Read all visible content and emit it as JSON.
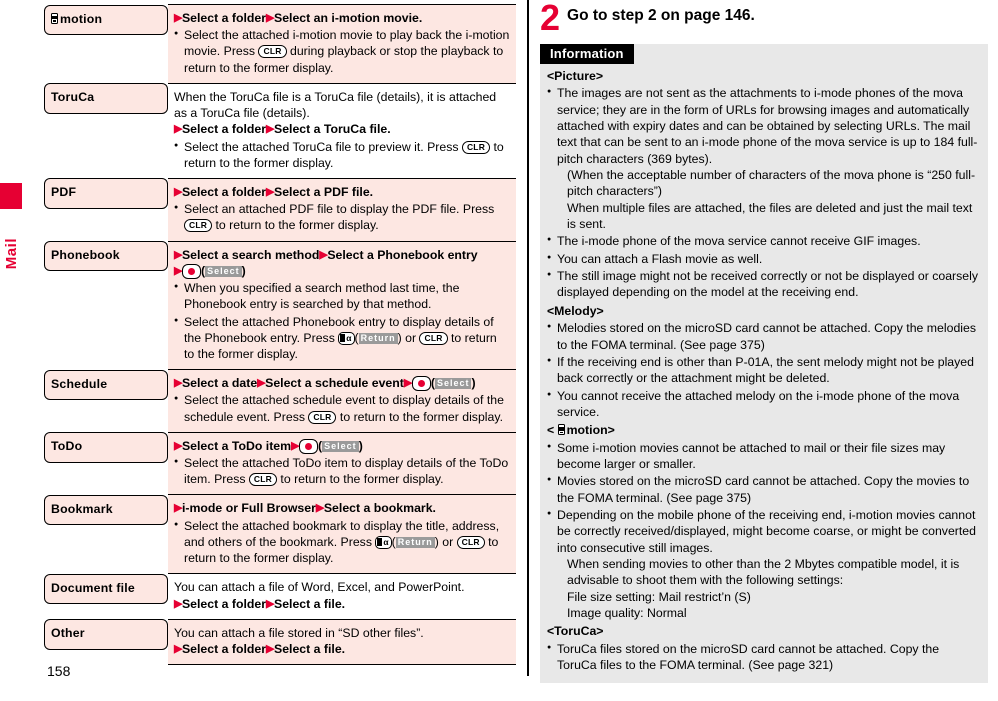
{
  "side_tab": {
    "label": "Mail"
  },
  "page_number": "158",
  "table": {
    "rows": [
      {
        "key_icon": "i-motion-glyph",
        "key": "motion",
        "value_bg": "pink",
        "lines": [
          {
            "type": "steps",
            "steps": [
              "Select a folder",
              "Select an i-motion movie."
            ]
          },
          {
            "type": "bullet",
            "parts": [
              {
                "t": "text",
                "v": "Select the attached i-motion movie to play back the i-motion movie. Press "
              },
              {
                "t": "key",
                "v": "CLR"
              },
              {
                "t": "text",
                "v": " during playback or stop the playback to return to the former display."
              }
            ]
          }
        ]
      },
      {
        "key": "ToruCa",
        "value_bg": "white",
        "lines": [
          {
            "type": "plain",
            "parts": [
              {
                "t": "text",
                "v": "When the ToruCa file is a ToruCa file (details), it is attached as a ToruCa file (details)."
              }
            ]
          },
          {
            "type": "steps",
            "steps": [
              "Select a folder",
              "Select a ToruCa file."
            ]
          },
          {
            "type": "bullet",
            "parts": [
              {
                "t": "text",
                "v": "Select the attached ToruCa file to preview it. Press "
              },
              {
                "t": "key",
                "v": "CLR"
              },
              {
                "t": "text",
                "v": " to return to the former display."
              }
            ]
          }
        ]
      },
      {
        "key": "PDF",
        "value_bg": "pink",
        "lines": [
          {
            "type": "steps",
            "steps": [
              "Select a folder",
              "Select a PDF file."
            ]
          },
          {
            "type": "bullet",
            "parts": [
              {
                "t": "text",
                "v": "Select an attached PDF file to display the PDF file. Press "
              },
              {
                "t": "key",
                "v": "CLR"
              },
              {
                "t": "text",
                "v": " to return to the former display."
              }
            ]
          }
        ]
      },
      {
        "key": "Phonebook",
        "value_bg": "pink",
        "lines": [
          {
            "type": "steps",
            "steps": [
              "Select a search method",
              "Select a Phonebook entry"
            ]
          },
          {
            "type": "steps_keys",
            "parts": [
              {
                "t": "arrow"
              },
              {
                "t": "center"
              },
              {
                "t": "text",
                "v": "("
              },
              {
                "t": "soft",
                "v": "Select"
              },
              {
                "t": "text",
                "v": ")"
              }
            ]
          },
          {
            "type": "bullet",
            "parts": [
              {
                "t": "text",
                "v": "When you specified a search method last time, the Phonebook entry is searched by that method."
              }
            ]
          },
          {
            "type": "bullet",
            "parts": [
              {
                "t": "text",
                "v": "Select the attached Phonebook entry to display details of the Phonebook entry. Press "
              },
              {
                "t": "ikey"
              },
              {
                "t": "text",
                "v": "("
              },
              {
                "t": "soft",
                "v": "Return"
              },
              {
                "t": "text",
                "v": ") or "
              },
              {
                "t": "key",
                "v": "CLR"
              },
              {
                "t": "text",
                "v": " to return to the former display."
              }
            ]
          }
        ]
      },
      {
        "key": "Schedule",
        "value_bg": "pink",
        "lines": [
          {
            "type": "steps_inline",
            "parts": [
              {
                "t": "arrow"
              },
              {
                "t": "bold",
                "v": "Select a date"
              },
              {
                "t": "arrow"
              },
              {
                "t": "bold",
                "v": "Select a schedule event"
              },
              {
                "t": "arrow"
              },
              {
                "t": "center"
              },
              {
                "t": "text",
                "v": "("
              },
              {
                "t": "soft",
                "v": "Select"
              },
              {
                "t": "text",
                "v": ")"
              }
            ]
          },
          {
            "type": "bullet",
            "parts": [
              {
                "t": "text",
                "v": "Select the attached schedule event to display details of the schedule event. Press "
              },
              {
                "t": "key",
                "v": "CLR"
              },
              {
                "t": "text",
                "v": " to return to the former display."
              }
            ]
          }
        ]
      },
      {
        "key": "ToDo",
        "value_bg": "pink",
        "lines": [
          {
            "type": "steps_inline",
            "parts": [
              {
                "t": "arrow"
              },
              {
                "t": "bold",
                "v": "Select a ToDo item"
              },
              {
                "t": "arrow"
              },
              {
                "t": "center"
              },
              {
                "t": "text",
                "v": "("
              },
              {
                "t": "soft",
                "v": "Select"
              },
              {
                "t": "text",
                "v": ")"
              }
            ]
          },
          {
            "type": "bullet",
            "parts": [
              {
                "t": "text",
                "v": "Select the attached ToDo item to display details of the ToDo item. Press "
              },
              {
                "t": "key",
                "v": "CLR"
              },
              {
                "t": "text",
                "v": " to return to the former display."
              }
            ]
          }
        ]
      },
      {
        "key": "Bookmark",
        "value_bg": "pink",
        "lines": [
          {
            "type": "steps",
            "steps": [
              "i-mode or Full Browser",
              "Select a bookmark."
            ]
          },
          {
            "type": "bullet",
            "parts": [
              {
                "t": "text",
                "v": "Select the attached bookmark to display the title, address, and others of the bookmark. Press "
              },
              {
                "t": "ikey"
              },
              {
                "t": "text",
                "v": "("
              },
              {
                "t": "soft",
                "v": "Return"
              },
              {
                "t": "text",
                "v": ") or "
              },
              {
                "t": "key",
                "v": "CLR"
              },
              {
                "t": "text",
                "v": " to return to the former display."
              }
            ]
          }
        ]
      },
      {
        "key": "Document file",
        "value_bg": "white",
        "lines": [
          {
            "type": "plain",
            "parts": [
              {
                "t": "text",
                "v": "You can attach a file of Word, Excel, and PowerPoint."
              }
            ]
          },
          {
            "type": "steps",
            "steps": [
              "Select a folder",
              "Select a file."
            ]
          }
        ]
      },
      {
        "key": "Other",
        "value_bg": "pink",
        "lines": [
          {
            "type": "plain",
            "parts": [
              {
                "t": "text",
                "v": "You can attach a file stored in “SD other files”."
              }
            ]
          },
          {
            "type": "steps",
            "steps": [
              "Select a folder",
              "Select a file."
            ]
          }
        ]
      }
    ]
  },
  "step": {
    "number": "2",
    "text": "Go to step 2 on page 146."
  },
  "information": {
    "title": "Information",
    "sections": [
      {
        "heading": "<Picture>",
        "heading_icon": null,
        "items": [
          {
            "type": "bullet",
            "text": "The images are not sent as the attachments to i-mode phones of the mova service; they are in the form of URLs for browsing images and automatically attached with expiry dates and can be obtained by selecting URLs. The mail text that can be sent to an i-mode phone of the mova service is up to 184 full-pitch characters (369 bytes)."
          },
          {
            "type": "cont",
            "text": "(When the acceptable number of characters of the mova phone is “250 full-pitch characters”)"
          },
          {
            "type": "cont",
            "text": "When multiple files are attached, the files are deleted and just the mail text is sent."
          },
          {
            "type": "bullet",
            "text": "The i-mode phone of the mova service cannot receive GIF images."
          },
          {
            "type": "bullet",
            "text": "You can attach a Flash movie as well."
          },
          {
            "type": "bullet",
            "text": "The still image might not be received correctly or not be displayed or coarsely displayed depending on the model at the receiving end."
          }
        ]
      },
      {
        "heading": "<Melody>",
        "heading_icon": null,
        "items": [
          {
            "type": "bullet",
            "text": "Melodies stored on the microSD card cannot be attached. Copy the melodies to the FOMA terminal. (See page 375)"
          },
          {
            "type": "bullet",
            "text": "If the receiving end is other than P-01A, the sent melody might not be played back correctly or the attachment might be deleted."
          },
          {
            "type": "bullet",
            "text": "You cannot receive the attached melody on the i-mode phone of the mova service."
          }
        ]
      },
      {
        "heading": "motion>",
        "heading_prefix": "<",
        "heading_icon": "i-motion-glyph",
        "items": [
          {
            "type": "bullet",
            "text": "Some i-motion movies cannot be attached to mail or their file sizes may become larger or smaller."
          },
          {
            "type": "bullet",
            "text": "Movies stored on the microSD card cannot be attached. Copy the movies to the FOMA terminal. (See page 375)"
          },
          {
            "type": "bullet",
            "text": "Depending on the mobile phone of the receiving end, i-motion movies cannot be correctly received/displayed, might become coarse, or might be converted into consecutive still images."
          },
          {
            "type": "cont",
            "text": "When sending movies to other than the 2 Mbytes compatible model, it is advisable to shoot them with the following settings:"
          },
          {
            "type": "cont",
            "text": "File size setting: Mail restrict’n (S)"
          },
          {
            "type": "cont",
            "text": "Image quality: Normal"
          }
        ]
      },
      {
        "heading": "<ToruCa>",
        "heading_icon": null,
        "items": [
          {
            "type": "bullet",
            "text": "ToruCa files stored on the microSD card cannot be attached. Copy the ToruCa files to the FOMA terminal. (See page 321)"
          }
        ]
      }
    ]
  },
  "colors": {
    "accent_red": "#e60033",
    "table_pink": "#fde7e2",
    "info_gray": "#e8e8e8",
    "softkey_gray": "#9a9a9a"
  }
}
